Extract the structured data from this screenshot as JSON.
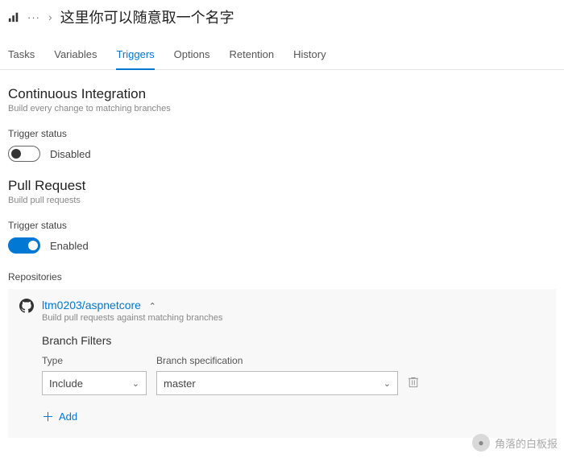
{
  "header": {
    "ellipsis": "···",
    "chevron": "›",
    "title": "这里你可以随意取一个名字"
  },
  "tabs": [
    {
      "label": "Tasks",
      "active": false
    },
    {
      "label": "Variables",
      "active": false
    },
    {
      "label": "Triggers",
      "active": true
    },
    {
      "label": "Options",
      "active": false
    },
    {
      "label": "Retention",
      "active": false
    },
    {
      "label": "History",
      "active": false
    }
  ],
  "ci": {
    "title": "Continuous Integration",
    "desc": "Build every change to matching branches",
    "status_label": "Trigger status",
    "toggle_value": "Disabled",
    "toggle_on": false
  },
  "pr": {
    "title": "Pull Request",
    "desc": "Build pull requests",
    "status_label": "Trigger status",
    "toggle_value": "Enabled",
    "toggle_on": true,
    "repos_label": "Repositories",
    "repo": {
      "name": "ltm0203/aspnetcore",
      "desc": "Build pull requests against matching branches",
      "expanded": true,
      "filters_title": "Branch Filters",
      "type_label": "Type",
      "branch_label": "Branch specification",
      "type_value": "Include",
      "branch_value": "master",
      "add_label": "Add"
    }
  },
  "watermark": "角落的白板报"
}
